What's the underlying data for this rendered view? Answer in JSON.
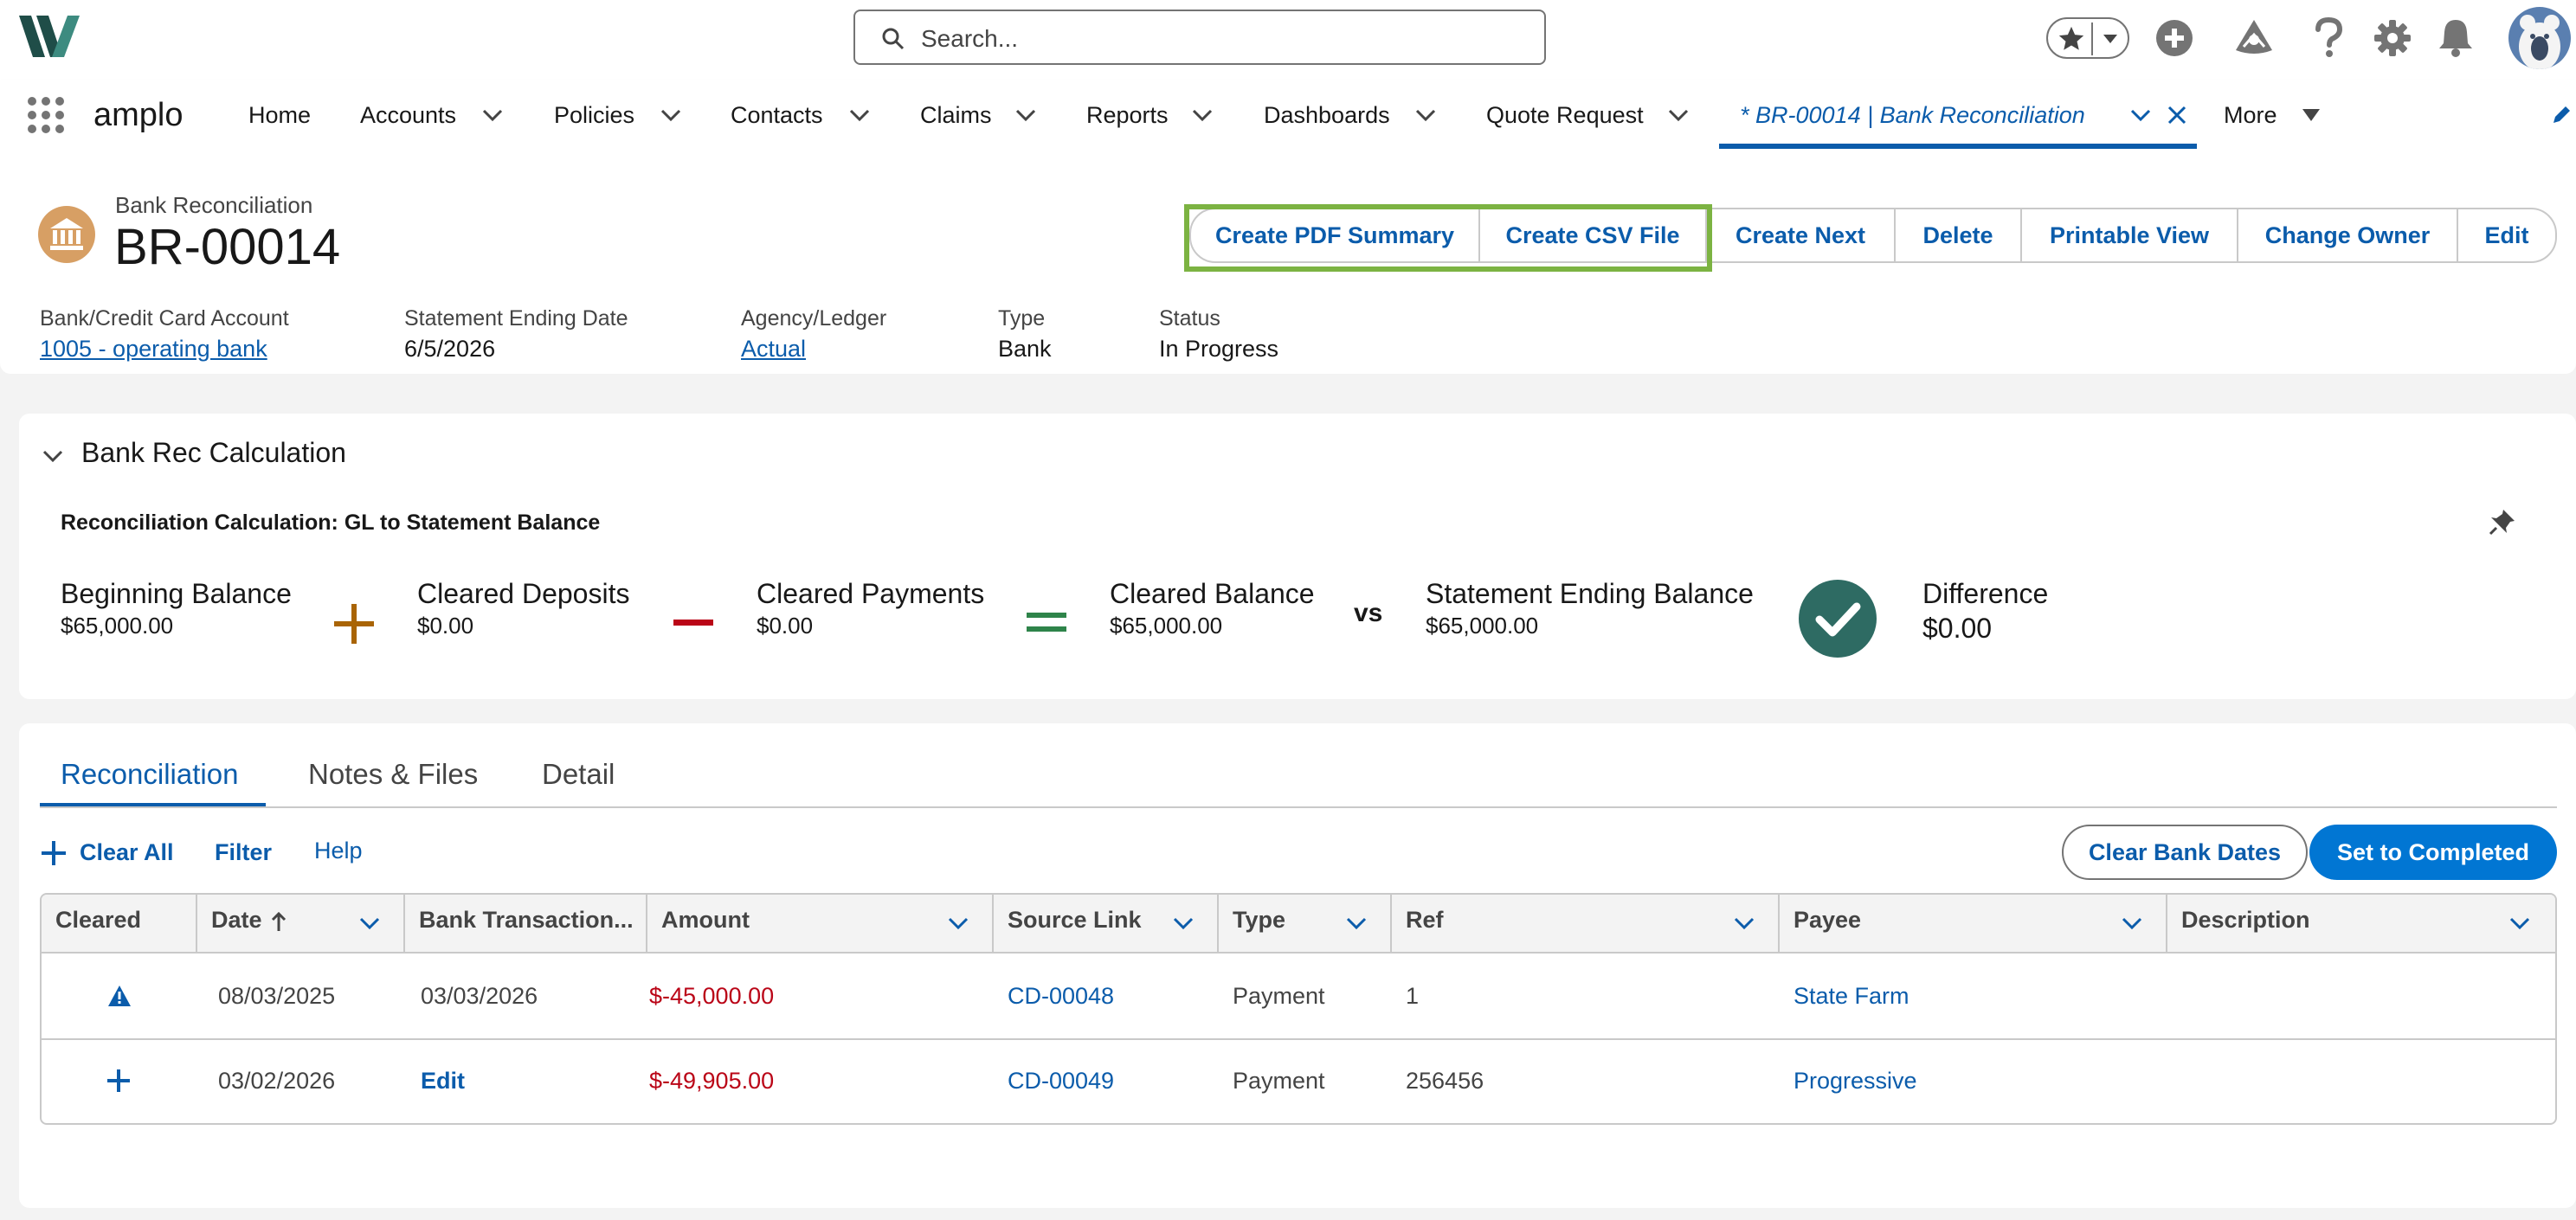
{
  "header": {
    "search_placeholder": "Search...",
    "icons": [
      "favorites-star-icon",
      "add-icon",
      "trailhead-icon",
      "help-icon",
      "setup-gear-icon",
      "notifications-bell-icon",
      "user-avatar"
    ]
  },
  "nav": {
    "app_name": "amplo",
    "items": [
      {
        "label": "Home"
      },
      {
        "label": "Accounts"
      },
      {
        "label": "Policies"
      },
      {
        "label": "Contacts"
      },
      {
        "label": "Claims"
      },
      {
        "label": "Reports"
      },
      {
        "label": "Dashboards"
      },
      {
        "label": "Quote Request"
      }
    ],
    "active_tab": "* BR-00014 | Bank Reconciliation",
    "more": "More"
  },
  "record": {
    "object_label": "Bank Reconciliation",
    "name": "BR-00014",
    "actions": [
      "Create PDF Summary",
      "Create CSV File",
      "Create Next",
      "Delete",
      "Printable View",
      "Change Owner",
      "Edit"
    ],
    "fields": [
      {
        "label": "Bank/Credit Card Account",
        "value": "1005 - operating bank"
      },
      {
        "label": "Statement Ending Date",
        "value": "6/5/2026"
      },
      {
        "label": "Agency/Ledger",
        "value": "Actual"
      },
      {
        "label": "Type",
        "value": "Bank"
      },
      {
        "label": "Status",
        "value": "In Progress"
      }
    ]
  },
  "calc": {
    "section_title": "Bank Rec Calculation",
    "subtitle": "Reconciliation Calculation: GL to Statement Balance",
    "beginning_label": "Beginning Balance",
    "beginning_value": "$65,000.00",
    "deposits_label": "Cleared Deposits",
    "deposits_value": "$0.00",
    "payments_label": "Cleared Payments",
    "payments_value": "$0.00",
    "cleared_label": "Cleared Balance",
    "cleared_value": "$65,000.00",
    "vs": "vs",
    "statement_label": "Statement Ending Balance",
    "statement_value": "$65,000.00",
    "difference_label": "Difference",
    "difference_value": "$0.00"
  },
  "tabs": [
    "Reconciliation",
    "Notes & Files",
    "Detail"
  ],
  "toolbar": {
    "clear_all": "Clear All",
    "filter": "Filter",
    "help": "Help",
    "clear_bank_dates": "Clear Bank Dates",
    "set_completed": "Set to Completed"
  },
  "table": {
    "columns": [
      "Cleared",
      "Date",
      "Bank Transaction...",
      "Amount",
      "Source Link",
      "Type",
      "Ref",
      "Payee",
      "Description"
    ],
    "rows": [
      {
        "date": "08/03/2025",
        "bank_date": "03/03/2026",
        "amount": "$-45,000.00",
        "source": "CD-00048",
        "type": "Payment",
        "ref": "1",
        "payee": "State Farm",
        "description": ""
      },
      {
        "date": "03/02/2026",
        "bank_date": "Edit",
        "amount": "$-49,905.00",
        "source": "CD-00049",
        "type": "Payment",
        "ref": "256456",
        "payee": "Progressive",
        "description": ""
      }
    ]
  },
  "colors": {
    "brand_blue": "#0b5cab",
    "primary_button": "#0176d3",
    "negative_amount": "#ba0517",
    "highlight_green": "#7cb342",
    "check_teal": "#2e6b63"
  }
}
